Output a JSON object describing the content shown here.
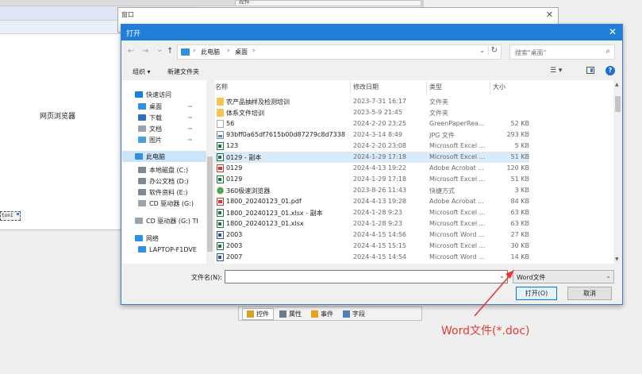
{
  "background": {
    "web_browser_label": "网页浏览器",
    "control_label": "ton1",
    "right_panel_label": "控件",
    "bottom_tabs": [
      {
        "label": "控件",
        "icon": "tools-icon"
      },
      {
        "label": "属性",
        "icon": "properties-icon"
      },
      {
        "label": "事件",
        "icon": "lightning-icon"
      },
      {
        "label": "字段",
        "icon": "fields-icon"
      }
    ]
  },
  "window": {
    "title": "窗口",
    "close": "✕"
  },
  "dialog": {
    "title": "打开",
    "close": "✕",
    "nav": {
      "back": "←",
      "forward": "→",
      "recent": "⌄",
      "up": "↑"
    },
    "address": {
      "crumbs": [
        "此电脑",
        "桌面"
      ],
      "sep": "›",
      "dropdown": "⌄",
      "refresh": "↻"
    },
    "search": {
      "placeholder": "搜索\"桌面\"",
      "icon": "⌕"
    },
    "toolbar": {
      "organize": "组织 ▾",
      "new_folder": "新建文件夹",
      "view": "☰ ▾",
      "help": "?"
    },
    "nav_pane": [
      {
        "label": "快速访问",
        "icon": "star-icon",
        "color": "#1f7fd8",
        "indent": 0,
        "pinned": false,
        "selected": false
      },
      {
        "label": "桌面",
        "icon": "desktop-icon",
        "color": "#2f8fe0",
        "indent": 1,
        "pinned": true,
        "selected": false
      },
      {
        "label": "下载",
        "icon": "download-icon",
        "color": "#2f6fc0",
        "indent": 1,
        "pinned": true,
        "selected": false
      },
      {
        "label": "文档",
        "icon": "document-icon",
        "color": "#9aa4ae",
        "indent": 1,
        "pinned": true,
        "selected": false
      },
      {
        "label": "图片",
        "icon": "picture-icon",
        "color": "#4aa0d8",
        "indent": 1,
        "pinned": true,
        "selected": false
      },
      {
        "label": "此电脑",
        "icon": "computer-icon",
        "color": "#2f8fe0",
        "indent": 0,
        "pinned": false,
        "selected": true
      },
      {
        "label": "本地磁盘 (C:)",
        "icon": "drive-icon",
        "color": "#7d8a96",
        "indent": 1,
        "pinned": false,
        "selected": false
      },
      {
        "label": "办公文档 (D:)",
        "icon": "drive-icon",
        "color": "#7d8a96",
        "indent": 1,
        "pinned": false,
        "selected": false
      },
      {
        "label": "软件资料 (E:)",
        "icon": "drive-icon",
        "color": "#7d8a96",
        "indent": 1,
        "pinned": false,
        "selected": false
      },
      {
        "label": "CD 驱动器 (G:)",
        "icon": "cd-drive-icon",
        "color": "#9aa4ae",
        "indent": 1,
        "pinned": false,
        "selected": false
      },
      {
        "label": "CD 驱动器 (G:) TI",
        "icon": "cd-drive-icon",
        "color": "#9aa4ae",
        "indent": 0,
        "pinned": false,
        "selected": false
      },
      {
        "label": "网络",
        "icon": "network-icon",
        "color": "#2f8fe0",
        "indent": 0,
        "pinned": false,
        "selected": false
      },
      {
        "label": "LAPTOP-F1DVE",
        "icon": "computer-icon",
        "color": "#2f8fe0",
        "indent": 1,
        "pinned": false,
        "selected": false
      }
    ],
    "columns": {
      "name": "名称",
      "date": "修改日期",
      "type": "类型",
      "size": "大小",
      "sort_caret": "⌃"
    },
    "files": [
      {
        "name": "农产品抽样及检测培训",
        "date": "2023-7-31 16:17",
        "type": "文件夹",
        "size": "",
        "icon": "folder"
      },
      {
        "name": "体系文件培训",
        "date": "2023-5-9 21:45",
        "type": "文件夹",
        "size": "",
        "icon": "folder"
      },
      {
        "name": "56",
        "date": "2024-2-20 23:25",
        "type": "GreenPaperRea...",
        "size": "52 KB",
        "icon": "blank"
      },
      {
        "name": "93bff0a65df7615b00d87279c8d7338",
        "date": "2024-3-14 8:49",
        "type": "JPG 文件",
        "size": "293 KB",
        "icon": "img"
      },
      {
        "name": "123",
        "date": "2024-2-20 23:08",
        "type": "Microsoft Excel ...",
        "size": "5 KB",
        "icon": "excel"
      },
      {
        "name": "0129 - 副本",
        "date": "2024-1-29 17:18",
        "type": "Microsoft Excel ...",
        "size": "51 KB",
        "icon": "excel",
        "selected": true
      },
      {
        "name": "0129",
        "date": "2024-4-13 19:22",
        "type": "Adobe Acrobat ...",
        "size": "120 KB",
        "icon": "pdf"
      },
      {
        "name": "0129",
        "date": "2024-1-29 17:18",
        "type": "Microsoft Excel ...",
        "size": "51 KB",
        "icon": "excel"
      },
      {
        "name": "360极速浏览器",
        "date": "2023-8-26 11:43",
        "type": "快捷方式",
        "size": "3 KB",
        "icon": "link"
      },
      {
        "name": "1800_20240123_01.pdf",
        "date": "2024-4-13 19:28",
        "type": "Adobe Acrobat ...",
        "size": "84 KB",
        "icon": "pdf"
      },
      {
        "name": "1800_20240123_01.xlsx - 副本",
        "date": "2024-1-28 9:23",
        "type": "Microsoft Excel ...",
        "size": "63 KB",
        "icon": "excel"
      },
      {
        "name": "1800_20240123_01.xlsx",
        "date": "2024-1-28 9:23",
        "type": "Microsoft Excel ...",
        "size": "63 KB",
        "icon": "excel"
      },
      {
        "name": "2003",
        "date": "2024-4-15 14:56",
        "type": "Microsoft Word ...",
        "size": "27 KB",
        "icon": "word"
      },
      {
        "name": "2003",
        "date": "2024-4-15 15:15",
        "type": "Microsoft Excel ...",
        "size": "30 KB",
        "icon": "excel"
      },
      {
        "name": "2007",
        "date": "2024-4-15 14:54",
        "type": "Microsoft Word ...",
        "size": "14 KB",
        "icon": "word"
      }
    ],
    "filename": {
      "label": "文件名(N):",
      "value": "",
      "dropdown": "⌄"
    },
    "filter": {
      "value": "Word文件",
      "dropdown": "⌄"
    },
    "buttons": {
      "open": "打开(O)",
      "cancel": "取消"
    }
  },
  "annotation": {
    "text": "Word文件(*.doc)",
    "color": "#e53935"
  },
  "colors": {
    "titlebar": "#1f7fd8",
    "selection": "#cce4f7",
    "accent": "#0078d7"
  }
}
